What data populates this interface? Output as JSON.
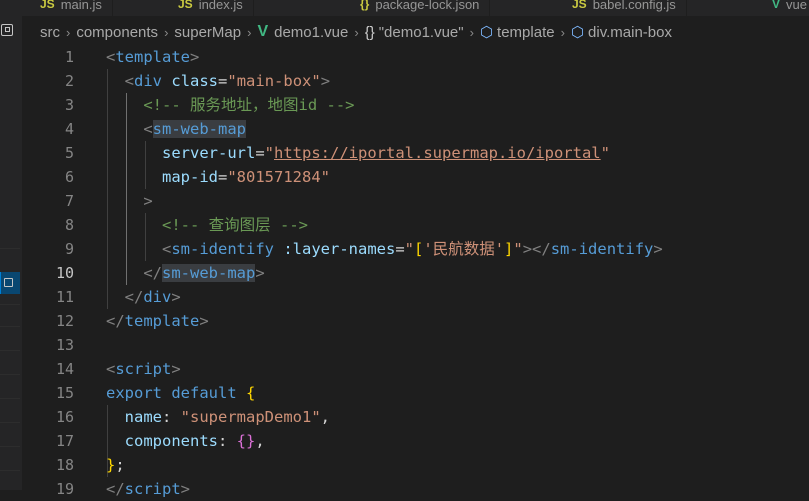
{
  "tabs": [
    {
      "icon": "JS",
      "label": "main.js"
    },
    {
      "icon": "JS",
      "label": "index.js"
    },
    {
      "icon": "{}",
      "label": "package-lock.json"
    },
    {
      "icon": "JS",
      "label": "babel.config.js"
    },
    {
      "icon": "V",
      "label": "vue"
    }
  ],
  "breadcrumb": [
    "src",
    "components",
    "superMap",
    "demo1.vue",
    "\"demo1.vue\"",
    "template",
    "div.main-box"
  ],
  "line_numbers": [
    "1",
    "2",
    "3",
    "4",
    "5",
    "6",
    "7",
    "8",
    "9",
    "10",
    "11",
    "12",
    "13",
    "14",
    "15",
    "16",
    "17",
    "18",
    "19"
  ],
  "active_line": "10",
  "code": {
    "l1_open": "<",
    "l1_tag": "template",
    "l1_close": ">",
    "l2_open": "<",
    "l2_tag": "div",
    "l2_attr": "class",
    "l2_eq": "=",
    "l2_val": "\"main-box\"",
    "l2_close": ">",
    "l3_comment": "<!-- 服务地址，地图id -->",
    "l4_open": "<",
    "l4_tag": "sm-web-map",
    "l5_attr": "server-url",
    "l5_eq": "=",
    "l5_q1": "\"",
    "l5_url": "https://iportal.supermap.io/iportal",
    "l5_q2": "\"",
    "l6_attr": "map-id",
    "l6_eq": "=",
    "l6_val": "\"801571284\"",
    "l7_close": ">",
    "l8_comment": "<!-- 查询图层 -->",
    "l9_open": "<",
    "l9_tag": "sm-identify",
    "l9_attr": ":layer-names",
    "l9_eq": "=",
    "l9_q1": "\"",
    "l9_br1": "[",
    "l9_str": "'民航数据'",
    "l9_br2": "]",
    "l9_q2": "\"",
    "l9_mid": "></",
    "l9_tag2": "sm-identify",
    "l9_end": ">",
    "l10_open": "</",
    "l10_tag": "sm-web-map",
    "l10_close": ">",
    "l11_open": "</",
    "l11_tag": "div",
    "l11_close": ">",
    "l12_open": "</",
    "l12_tag": "template",
    "l12_close": ">",
    "l14_open": "<",
    "l14_tag": "script",
    "l14_close": ">",
    "l15_kw": "export default",
    "l15_brace": "{",
    "l16_key": "name",
    "l16_colon": ": ",
    "l16_val": "\"supermapDemo1\"",
    "l16_comma": ",",
    "l17_key": "components",
    "l17_colon": ": ",
    "l17_val": "{}",
    "l17_comma": ",",
    "l18_brace": "}",
    "l18_semi": ";",
    "l19_open": "</",
    "l19_tag": "script",
    "l19_close": ">"
  },
  "colors": {
    "background": "#1e1e1e",
    "tag": "#569cd6",
    "attribute": "#9cdcfe",
    "string": "#ce9178",
    "comment": "#6a9955",
    "bracket_gold": "#ffd700",
    "bracket_purple": "#da70d6"
  }
}
